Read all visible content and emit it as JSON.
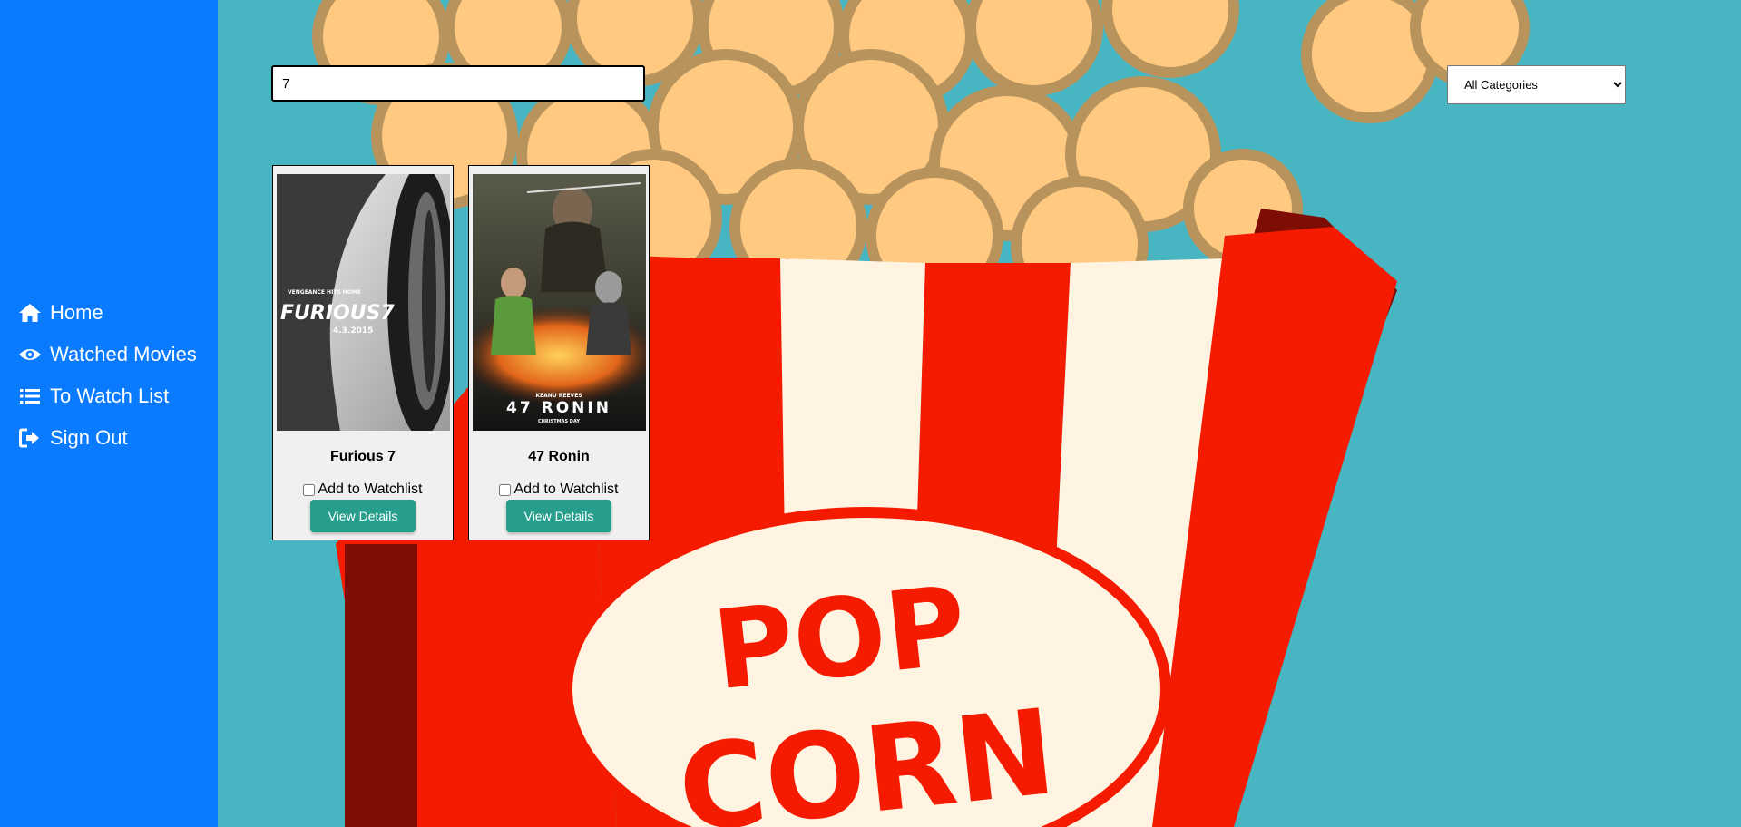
{
  "sidebar": {
    "items": [
      {
        "label": "Home",
        "icon": "home-icon"
      },
      {
        "label": "Watched Movies",
        "icon": "eye-icon"
      },
      {
        "label": "To Watch List",
        "icon": "list-icon"
      },
      {
        "label": "Sign Out",
        "icon": "sign-out-icon"
      }
    ]
  },
  "search": {
    "value": "7"
  },
  "category": {
    "selected": "All Categories"
  },
  "movies": [
    {
      "title": "Furious 7",
      "watchlist_label": "Add to Watchlist",
      "details_label": "View Details",
      "poster": {
        "tagline": "VENGEANCE HITS HOME",
        "logo": "FURIOUS7",
        "date": "4.3.2015"
      }
    },
    {
      "title": "47 Ronin",
      "watchlist_label": "Add to Watchlist",
      "details_label": "View Details",
      "poster": {
        "top": "KEANU REEVES",
        "logo": "47 RONIN",
        "bottom": "CHRISTMAS DAY"
      }
    }
  ],
  "background": {
    "line1": "POP",
    "line2": "CORN"
  },
  "colors": {
    "sidebar": "#0a7bff",
    "background": "#47b5c2",
    "button": "#279e8c",
    "popcorn": "#ffc982",
    "stripe_red": "#f41b00",
    "stripe_cream": "#fff4e2"
  }
}
